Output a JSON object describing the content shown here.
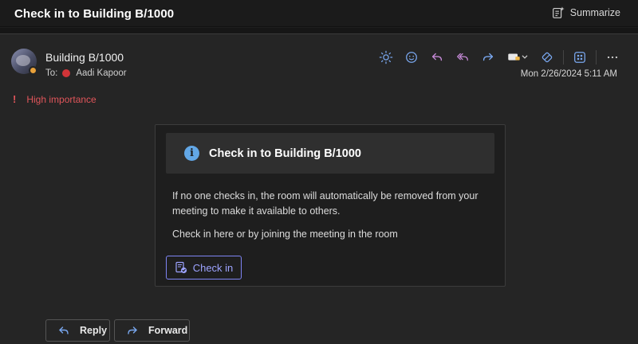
{
  "titlebar": {
    "subject": "Check in to Building B/1000",
    "summarize_label": "Summarize"
  },
  "message": {
    "sender": "Building B/1000",
    "to_label": "To:",
    "recipient": "Aadi Kapoor",
    "date": "Mon 2/26/2024 5:11 AM",
    "importance": "High importance",
    "importance_icon": "!"
  },
  "actions": [
    {
      "name": "sun-icon"
    },
    {
      "name": "emoji-icon"
    },
    {
      "name": "reply-icon"
    },
    {
      "name": "reply-all-icon"
    },
    {
      "name": "forward-icon"
    },
    {
      "name": "tag-dropdown-icon"
    },
    {
      "name": "sticker-icon"
    },
    {
      "name": "apps-icon"
    },
    {
      "name": "more-icon"
    }
  ],
  "card": {
    "info_icon": "i",
    "title": "Check in to Building B/1000",
    "body_line1": "If no one checks in, the room will automatically be removed from your meeting to make it available to others.",
    "body_line2": "Check in here or by joining the meeting in the room",
    "checkin_label": "Check in"
  },
  "footer": {
    "reply_label": "Reply",
    "forward_label": "Forward"
  },
  "colors": {
    "accent": "#7f85f5",
    "importance": "#e0555a",
    "info": "#62a7e6",
    "recipient_status": "#d13438",
    "avatar_status": "#e8a13a"
  }
}
